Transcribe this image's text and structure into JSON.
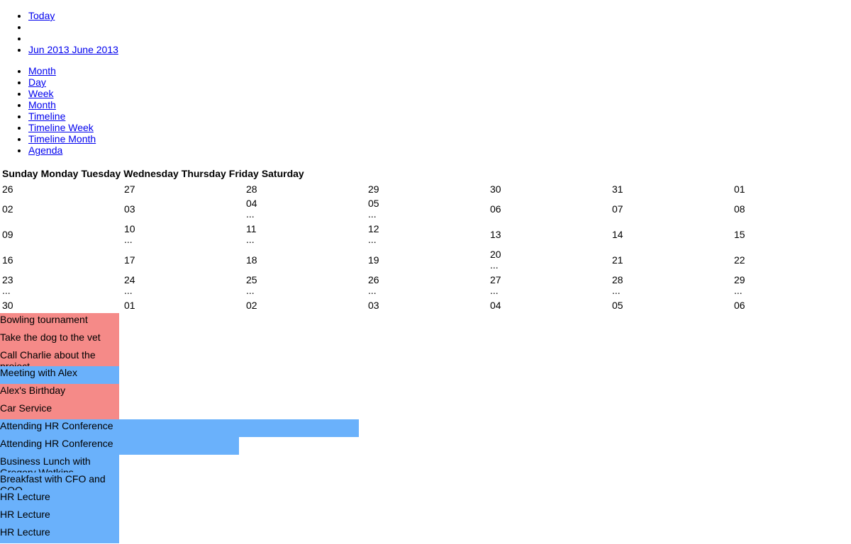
{
  "nav": {
    "today": "Today",
    "prev": "",
    "next": "",
    "current_range": "Jun 2013 June 2013"
  },
  "views": [
    "Month",
    "Day",
    "Week",
    "Month",
    "Timeline",
    "Timeline Week",
    "Timeline Month",
    "Agenda"
  ],
  "weekdays": [
    "Sunday",
    "Monday",
    "Tuesday",
    "Wednesday",
    "Thursday",
    "Friday",
    "Saturday"
  ],
  "weeks": [
    {
      "days": [
        {
          "n": "26",
          "more": ""
        },
        {
          "n": "27",
          "more": ""
        },
        {
          "n": "28",
          "more": ""
        },
        {
          "n": "29",
          "more": ""
        },
        {
          "n": "30",
          "more": ""
        },
        {
          "n": "31",
          "more": ""
        },
        {
          "n": "01",
          "more": ""
        }
      ]
    },
    {
      "days": [
        {
          "n": "02",
          "more": ""
        },
        {
          "n": "03",
          "more": ""
        },
        {
          "n": "04",
          "more": "..."
        },
        {
          "n": "05",
          "more": "..."
        },
        {
          "n": "06",
          "more": ""
        },
        {
          "n": "07",
          "more": ""
        },
        {
          "n": "08",
          "more": ""
        }
      ]
    },
    {
      "days": [
        {
          "n": "09",
          "more": ""
        },
        {
          "n": "10",
          "more": "..."
        },
        {
          "n": "11",
          "more": "..."
        },
        {
          "n": "12",
          "more": "..."
        },
        {
          "n": "13",
          "more": ""
        },
        {
          "n": "14",
          "more": ""
        },
        {
          "n": "15",
          "more": ""
        }
      ]
    },
    {
      "days": [
        {
          "n": "16",
          "more": ""
        },
        {
          "n": "17",
          "more": ""
        },
        {
          "n": "18",
          "more": ""
        },
        {
          "n": "19",
          "more": ""
        },
        {
          "n": "20",
          "more": "..."
        },
        {
          "n": "21",
          "more": ""
        },
        {
          "n": "22",
          "more": ""
        }
      ]
    },
    {
      "days": [
        {
          "n": "23",
          "more": "..."
        },
        {
          "n": "24",
          "more": "..."
        },
        {
          "n": "25",
          "more": "..."
        },
        {
          "n": "26",
          "more": "..."
        },
        {
          "n": "27",
          "more": "..."
        },
        {
          "n": "28",
          "more": "..."
        },
        {
          "n": "29",
          "more": "..."
        }
      ]
    },
    {
      "days": [
        {
          "n": "30",
          "more": ""
        },
        {
          "n": "01",
          "more": ""
        },
        {
          "n": "02",
          "more": ""
        },
        {
          "n": "03",
          "more": ""
        },
        {
          "n": "04",
          "more": ""
        },
        {
          "n": "05",
          "more": ""
        },
        {
          "n": "06",
          "more": ""
        }
      ]
    }
  ],
  "events": [
    {
      "title": "Bowling tournament",
      "color": "red",
      "span_days": 1
    },
    {
      "title": "Take the dog to the vet",
      "color": "red",
      "span_days": 1
    },
    {
      "title": "Call Charlie about the project",
      "color": "red",
      "span_days": 1
    },
    {
      "title": "Meeting with Alex",
      "color": "blue",
      "span_days": 1
    },
    {
      "title": "Alex's Birthday",
      "color": "red",
      "span_days": 1
    },
    {
      "title": "Car Service",
      "color": "red",
      "span_days": 1
    },
    {
      "title": "Attending HR Conference",
      "color": "blue",
      "span_days": 3
    },
    {
      "title": "Attending HR Conference",
      "color": "blue",
      "span_days": 2
    },
    {
      "title": "Business Lunch with Gregory Watkins",
      "color": "blue",
      "span_days": 1
    },
    {
      "title": "Breakfast with CFO and COO",
      "color": "blue",
      "span_days": 1
    },
    {
      "title": "HR Lecture",
      "color": "blue",
      "span_days": 1
    },
    {
      "title": "HR Lecture",
      "color": "blue",
      "span_days": 1
    },
    {
      "title": "HR Lecture",
      "color": "blue",
      "span_days": 1
    }
  ],
  "colors": {
    "red": "#f58a88",
    "blue": "#6ab1fb",
    "link": "#0000ee"
  }
}
